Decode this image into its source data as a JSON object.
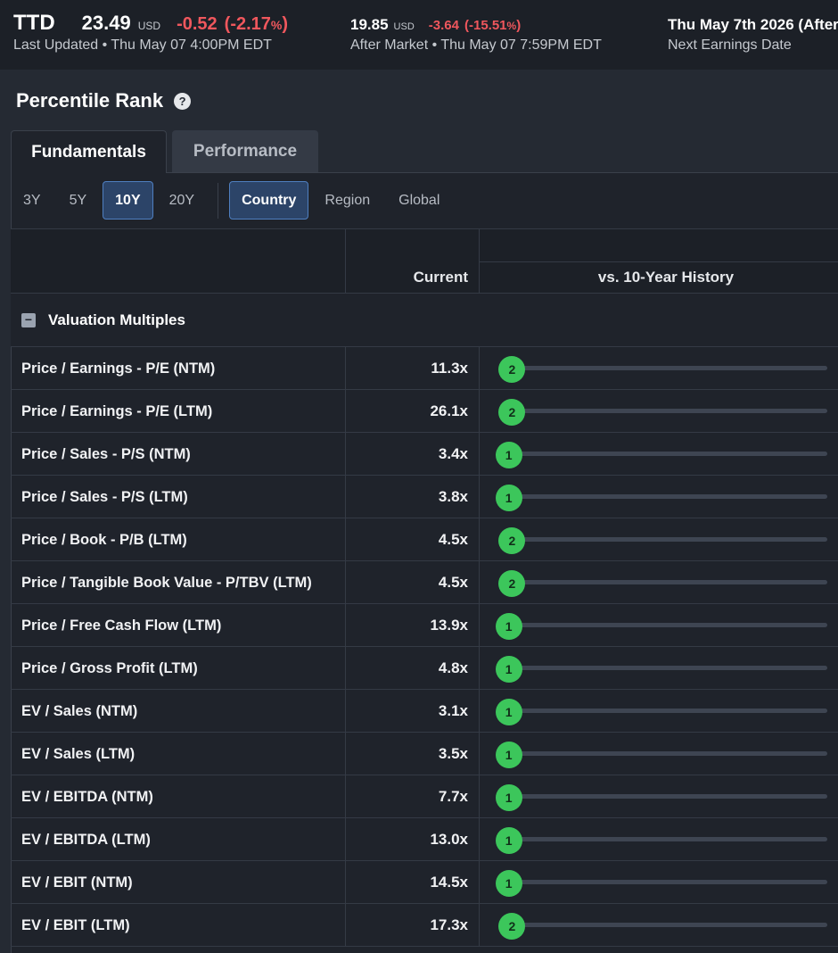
{
  "quote": {
    "ticker": "TTD",
    "price": "23.49",
    "currency": "USD",
    "change": "-0.52",
    "change_pct": "(-2.17",
    "pct_sign": "%",
    "pct_close": ")",
    "last_updated": "Last Updated • Thu May 07 4:00PM EDT"
  },
  "after_market": {
    "price": "19.85",
    "currency": "USD",
    "change": "-3.64",
    "change_pct": "(-15.51",
    "pct_sign": "%",
    "pct_close": ")",
    "label": "After Market • Thu May 07 7:59PM EDT"
  },
  "earnings": {
    "date": "Thu May 7th 2026 (After",
    "label": "Next Earnings Date"
  },
  "section": {
    "title": "Percentile Rank",
    "help": "?"
  },
  "tabs": [
    {
      "label": "Fundamentals",
      "active": true
    },
    {
      "label": "Performance",
      "active": false
    }
  ],
  "periods": [
    {
      "label": "3Y",
      "active": false
    },
    {
      "label": "5Y",
      "active": false
    },
    {
      "label": "10Y",
      "active": true
    },
    {
      "label": "20Y",
      "active": false
    }
  ],
  "scopes": [
    {
      "label": "Country",
      "active": true
    },
    {
      "label": "Region",
      "active": false
    },
    {
      "label": "Global",
      "active": false
    }
  ],
  "table": {
    "col_current": "Current",
    "col_history": "vs. 10-Year History",
    "group": {
      "toggle": "−",
      "label": "Valuation Multiples"
    },
    "rows": [
      {
        "name": "Price / Earnings - P/E (NTM)",
        "value": "11.3x",
        "rank": 2
      },
      {
        "name": "Price / Earnings - P/E (LTM)",
        "value": "26.1x",
        "rank": 2
      },
      {
        "name": "Price / Sales - P/S (NTM)",
        "value": "3.4x",
        "rank": 1
      },
      {
        "name": "Price / Sales - P/S (LTM)",
        "value": "3.8x",
        "rank": 1
      },
      {
        "name": "Price / Book - P/B (LTM)",
        "value": "4.5x",
        "rank": 2
      },
      {
        "name": "Price / Tangible Book Value - P/TBV (LTM)",
        "value": "4.5x",
        "rank": 2
      },
      {
        "name": "Price / Free Cash Flow (LTM)",
        "value": "13.9x",
        "rank": 1
      },
      {
        "name": "Price / Gross Profit (LTM)",
        "value": "4.8x",
        "rank": 1
      },
      {
        "name": "EV / Sales (NTM)",
        "value": "3.1x",
        "rank": 1
      },
      {
        "name": "EV / Sales (LTM)",
        "value": "3.5x",
        "rank": 1
      },
      {
        "name": "EV / EBITDA (NTM)",
        "value": "7.7x",
        "rank": 1
      },
      {
        "name": "EV / EBITDA (LTM)",
        "value": "13.0x",
        "rank": 1
      },
      {
        "name": "EV / EBIT (NTM)",
        "value": "14.5x",
        "rank": 1
      },
      {
        "name": "EV / EBIT (LTM)",
        "value": "17.3x",
        "rank": 2
      }
    ]
  },
  "colors": {
    "negative": "#f0575d",
    "rank_marker": "#3cc65b",
    "active_chip": "#2c4468"
  }
}
